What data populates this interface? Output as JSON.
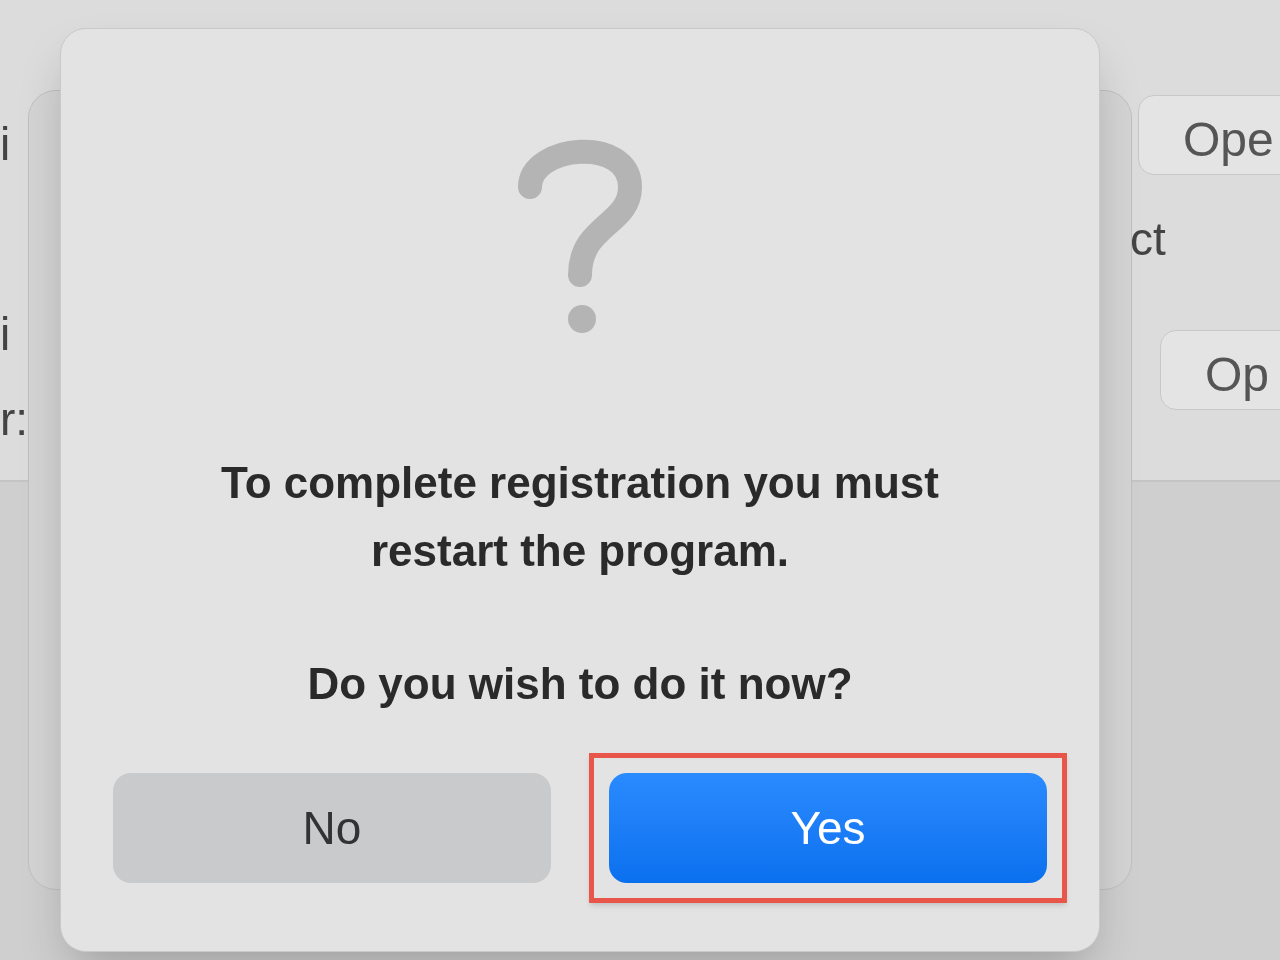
{
  "background": {
    "left_labels": [
      "i",
      "i",
      "r:"
    ],
    "right_label": "ct",
    "right_buttons": [
      "Ope",
      "Op"
    ]
  },
  "dialog": {
    "message": "To complete registration you must restart the program.",
    "question": "Do you wish to do it now?",
    "buttons": [
      {
        "label": "No",
        "default": false,
        "highlighted": false
      },
      {
        "label": "Yes",
        "default": true,
        "highlighted": true
      }
    ]
  }
}
